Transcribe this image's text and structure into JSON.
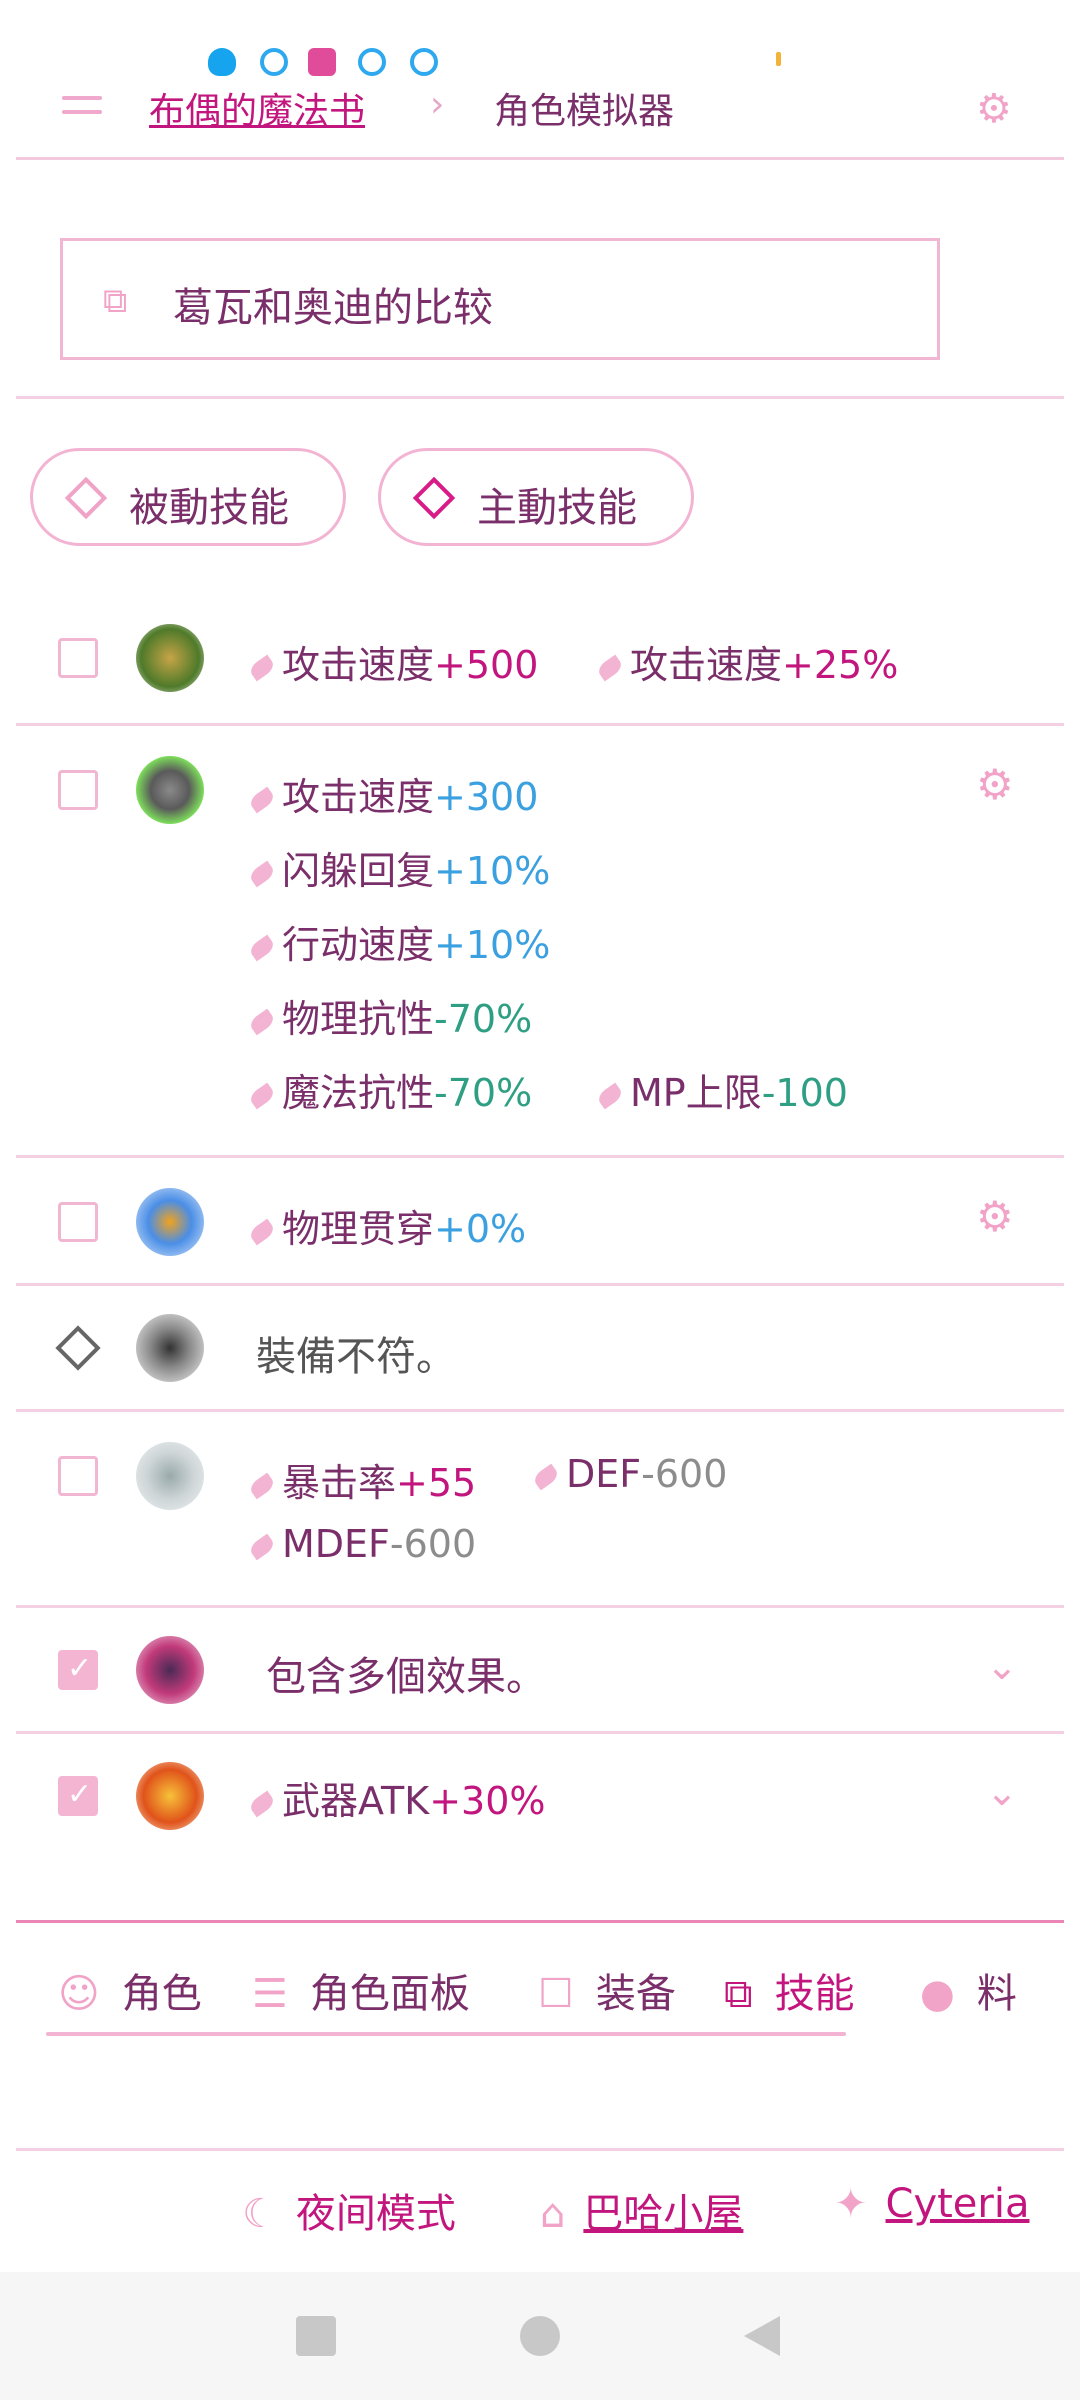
{
  "header": {
    "breadcrumb_link": "布偶的魔法书",
    "breadcrumb_sep": "›",
    "breadcrumb_current": "角色模拟器"
  },
  "compare": {
    "label": "葛瓦和奥迪的比较"
  },
  "skill_tabs": [
    {
      "label": "被動技能",
      "active": false
    },
    {
      "label": "主動技能",
      "active": true
    }
  ],
  "rows": [
    {
      "checked": false,
      "effects": [
        {
          "name": "攻击速度",
          "value": "+500",
          "tone": "pos"
        },
        {
          "name": "攻击速度",
          "value": "+25%",
          "tone": "pos"
        }
      ]
    },
    {
      "checked": false,
      "effects": [
        {
          "name": "攻击速度",
          "value": "+300",
          "tone": "blue"
        },
        {
          "name": "闪躲回复",
          "value": "+10%",
          "tone": "blue"
        },
        {
          "name": "行动速度",
          "value": "+10%",
          "tone": "blue"
        },
        {
          "name": "物理抗性",
          "value": "-70%",
          "tone": "neg"
        },
        {
          "name": "魔法抗性",
          "value": "-70%",
          "tone": "neg"
        },
        {
          "name": "MP上限",
          "value": "-100",
          "tone": "neg"
        }
      ]
    },
    {
      "checked": false,
      "effects": [
        {
          "name": "物理贯穿",
          "value": "+0%",
          "tone": "blue"
        }
      ]
    },
    {
      "note": "裝備不符。"
    },
    {
      "checked": false,
      "effects": [
        {
          "name": "暴击率",
          "value": "+55",
          "tone": "pos"
        },
        {
          "name": "DEF",
          "value": "-600",
          "tone": "gray"
        },
        {
          "name": "MDEF",
          "value": "-600",
          "tone": "gray"
        }
      ]
    },
    {
      "checked": true,
      "note": "包含多個效果。"
    },
    {
      "checked": true,
      "effects": [
        {
          "name": "武器ATK",
          "value": "+30%",
          "tone": "pos"
        }
      ]
    }
  ],
  "bottom_tabs": [
    {
      "label": "角色",
      "icon": "face-icon"
    },
    {
      "label": "角色面板",
      "icon": "person-list-icon"
    },
    {
      "label": "装备",
      "icon": "square-icon"
    },
    {
      "label": "技能",
      "icon": "skill-blocks-icon",
      "active": true
    },
    {
      "label": "料",
      "icon": "apple-icon"
    }
  ],
  "footer": {
    "night_mode": "夜间模式",
    "home": "巴哈小屋",
    "author": "Cyteria"
  },
  "colors": {
    "accent": "#c2157d",
    "border": "#f3b4d3",
    "text": "#7a2f6a"
  }
}
